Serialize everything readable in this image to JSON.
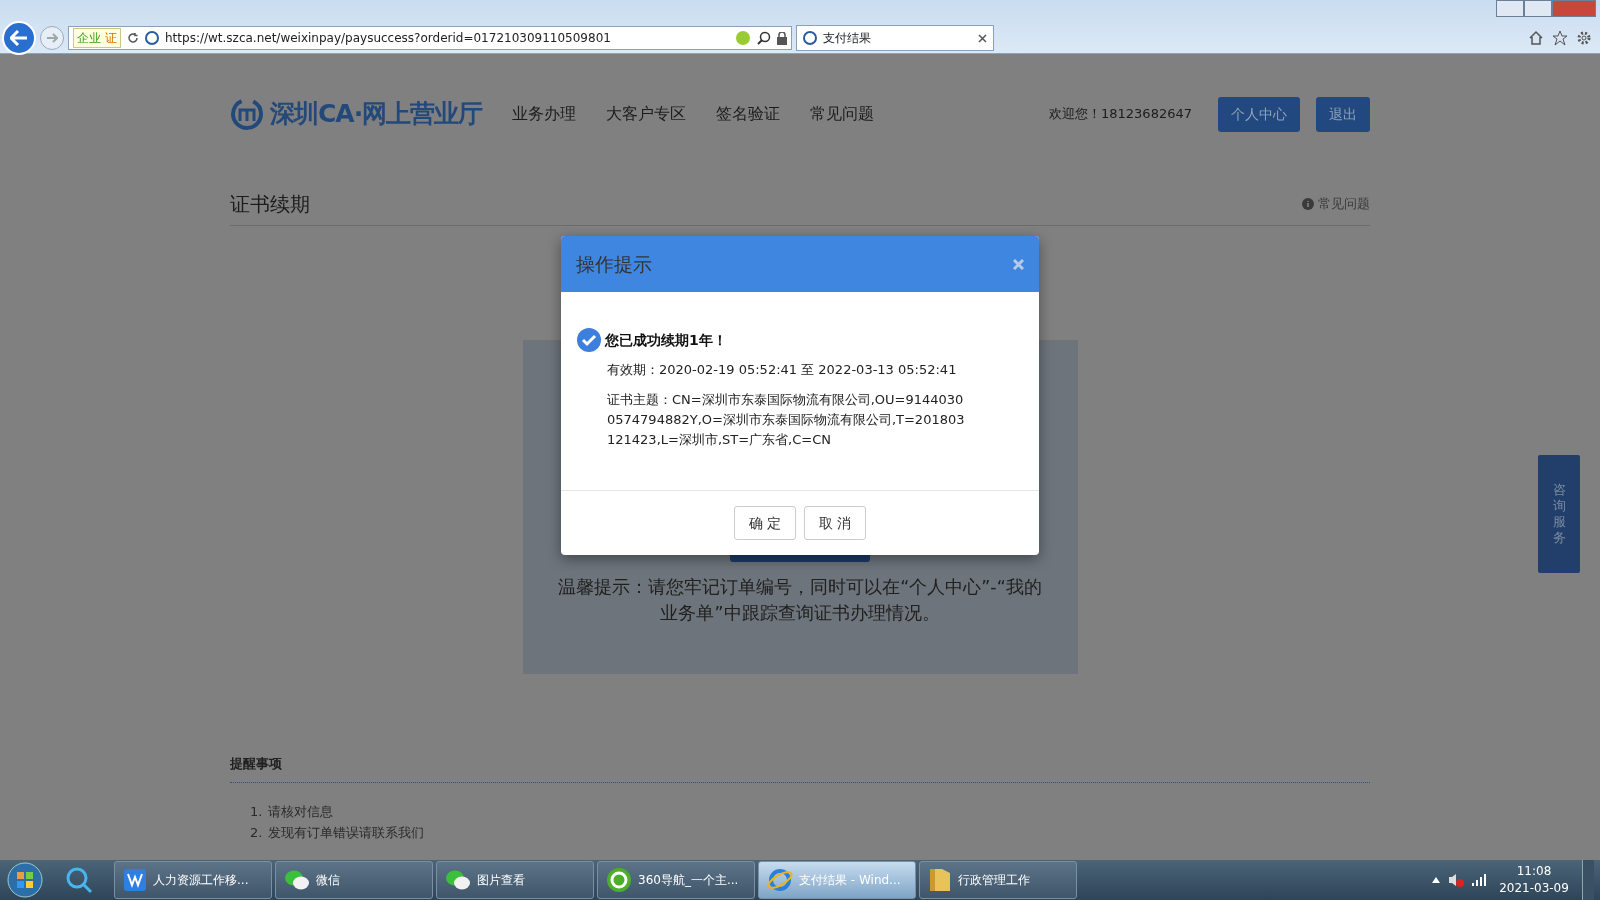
{
  "browser": {
    "address_badges": [
      "企业",
      "证"
    ],
    "url": "https://wt.szca.net/weixinpay/paysuccess?orderid=017210309110509801",
    "tab_title": "支付结果"
  },
  "header": {
    "logo_text": "深圳CA·网上营业厅",
    "nav": [
      "业务办理",
      "大客户专区",
      "签名验证",
      "常见问题"
    ],
    "welcome": "欢迎您！18123682647",
    "buttons": [
      "个人中心",
      "退出"
    ]
  },
  "page": {
    "title": "证书续期",
    "help_link": "常见问题",
    "tip": "温馨提示：请您牢记订单编号，同时可以在“个人中心”-“我的业务单”中跟踪查询证书办理情况。"
  },
  "reminders": {
    "title": "提醒事项",
    "items": [
      {
        "number": "1.",
        "text": "请核对信息"
      },
      {
        "number": "2.",
        "text": "发现有订单错误请联系我们"
      }
    ]
  },
  "side_tab": "咨询服务",
  "modal": {
    "title": "操作提示",
    "success": "您已成功续期1年！",
    "validity": "有效期：2020-02-19 05:52:41 至 2022-03-13 05:52:41",
    "subject": "证书主题：CN=深圳市东泰国际物流有限公司,OU=91440300574794882Y,O=深圳市东泰国际物流有限公司,T=201803121423,L=深圳市,ST=广东省,C=CN",
    "buttons": [
      "确 定",
      "取 消"
    ]
  },
  "taskbar": {
    "items": [
      {
        "kind": "doc",
        "label": "人力资源工作移...",
        "selected": false
      },
      {
        "kind": "chat",
        "label": "微信",
        "selected": false
      },
      {
        "kind": "chat",
        "label": "图片查看",
        "selected": false
      },
      {
        "kind": "nav",
        "label": "360导航_一个主...",
        "selected": false
      },
      {
        "kind": "ie",
        "label": "支付结果 - Wind...",
        "selected": true
      },
      {
        "kind": "folder",
        "label": "行政管理工作",
        "selected": false
      }
    ],
    "time": "11:08",
    "date": "2021-03-09"
  }
}
